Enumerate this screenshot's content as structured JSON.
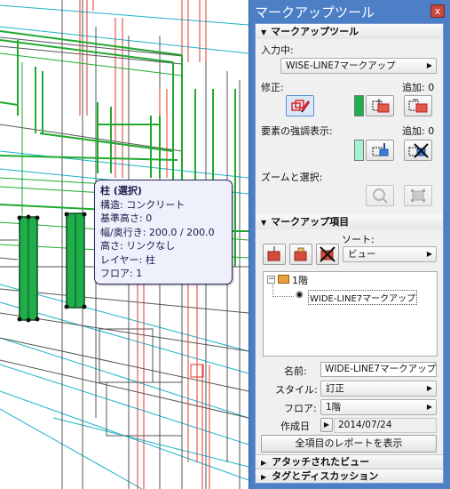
{
  "tooltip": {
    "title": "柱 (選択)",
    "rows": [
      "構造: コンクリート",
      "基準高さ: 0",
      "幅/奥行き: 200.0 / 200.0",
      "高さ: リンクなし",
      "レイヤー: 柱",
      "フロア: 1"
    ]
  },
  "palette": {
    "title": "マークアップツール",
    "close_glyph": "x",
    "section_markup_tool": "マークアップツール",
    "input_label": "入力中:",
    "input_value": "WISE-LINE7マークアップ",
    "modify_label": "修正:",
    "add_label_1": "追加: 0",
    "highlight_label": "要素の強調表示:",
    "add_label_2": "追加: 0",
    "zoom_label": "ズームと選択:",
    "section_markup_items": "マークアップ項目",
    "sort_label": "ソート:",
    "sort_value": "ビュー",
    "tree": {
      "floor_label": "1階",
      "item_label": "WIDE-LINE7マークアップ",
      "collapse_glyph": "−"
    },
    "name_label": "名前:",
    "name_value": "WIDE-LINE7マークアップ",
    "style_label": "スタイル:",
    "style_value": "訂正",
    "floor_label": "フロア:",
    "floor_value": "1階",
    "date_label": "作成日",
    "date_value": "2014/07/24",
    "report_button": "全項目のレポートを表示",
    "attached_views": "アタッチされたビュー",
    "tags_discussion": "タグとディスカッション"
  },
  "colors": {
    "title_bar": "#4d7fc7",
    "modify_swatch": "#1fae4a",
    "highlight_swatch": "#a8f0d0",
    "model_green": "#1faa2e",
    "model_red": "#e03a2a",
    "model_cyan": "#19b3c8"
  }
}
